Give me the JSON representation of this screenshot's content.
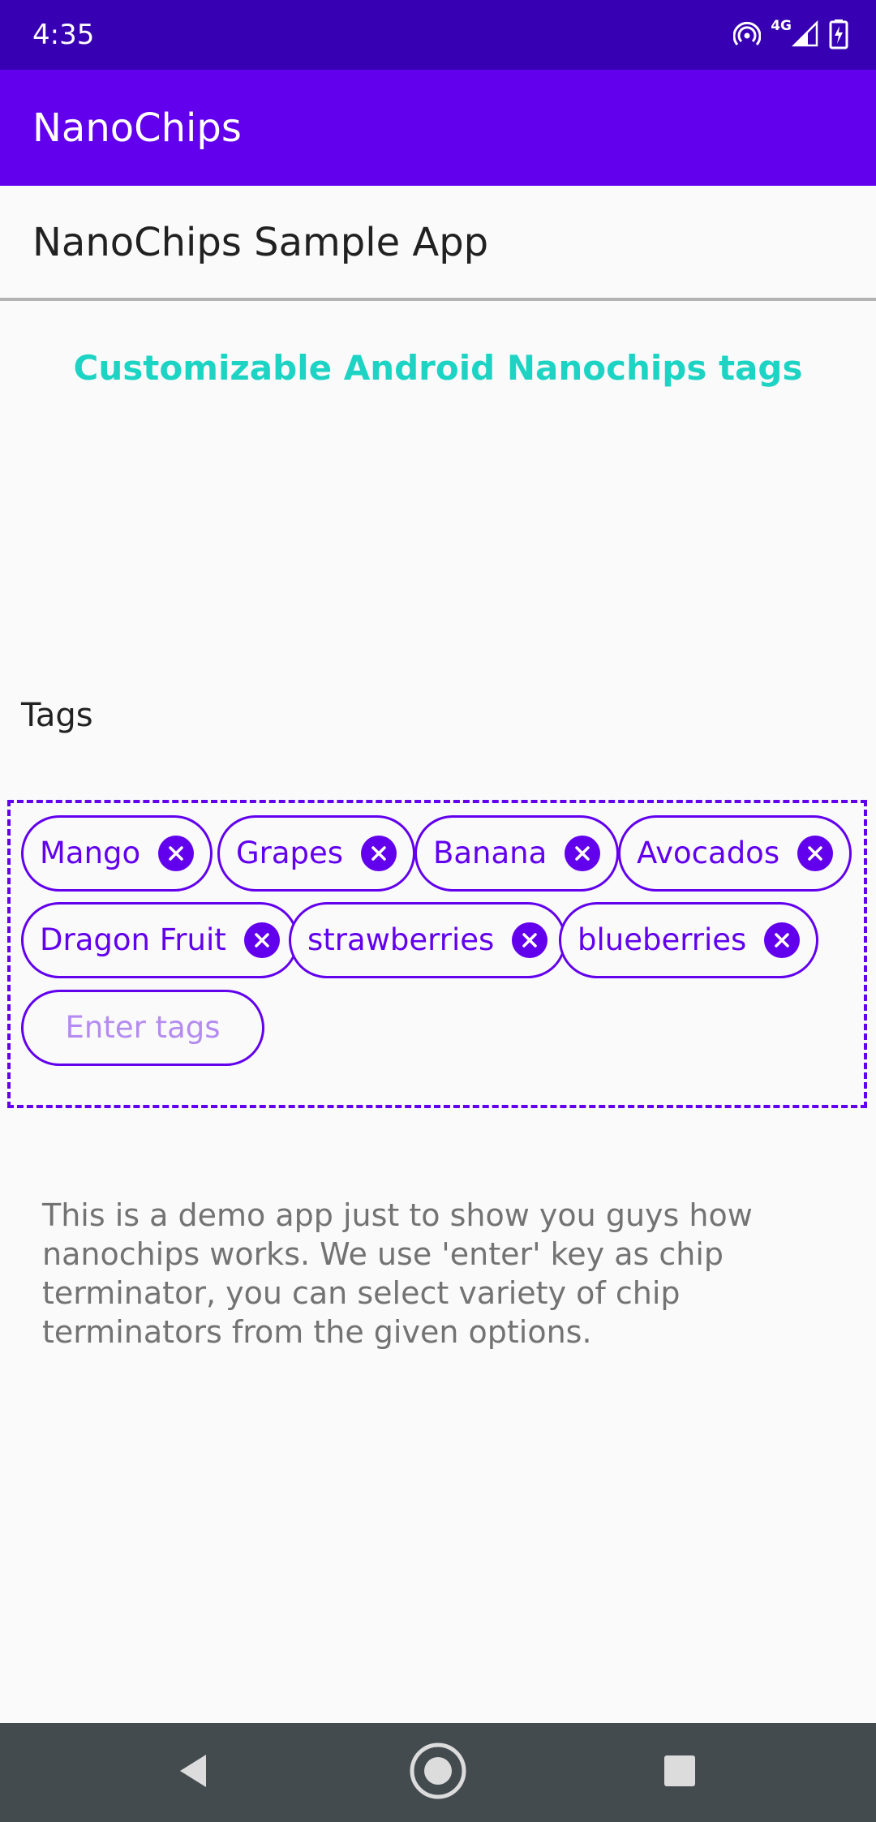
{
  "status_bar": {
    "time": "4:35",
    "network": "4G",
    "icons": [
      "hotspot-icon",
      "signal-icon",
      "battery-charging-icon"
    ]
  },
  "app_bar": {
    "title": "NanoChips"
  },
  "subheader": {
    "title": "NanoChips Sample App"
  },
  "headline": "Customizable Android Nanochips tags",
  "tags": {
    "label": "Tags",
    "chips": [
      "Mango",
      "Grapes",
      "Banana",
      "Avocados",
      "Dragon Fruit",
      "strawberries",
      "blueberries"
    ],
    "input_placeholder": "Enter tags"
  },
  "description": "This is a demo app just to show you guys how nanochips works. We use 'enter' key as chip terminator, you can select variety of chip terminators from the given options.",
  "nav_bar": {
    "icons": [
      "back-icon",
      "home-icon",
      "recents-icon"
    ]
  },
  "colors": {
    "status_bar": "#3700b3",
    "app_bar": "#6200ee",
    "accent_text": "#1dd4c4",
    "chip": "#6200ee",
    "nav_bar": "#444b4f"
  }
}
